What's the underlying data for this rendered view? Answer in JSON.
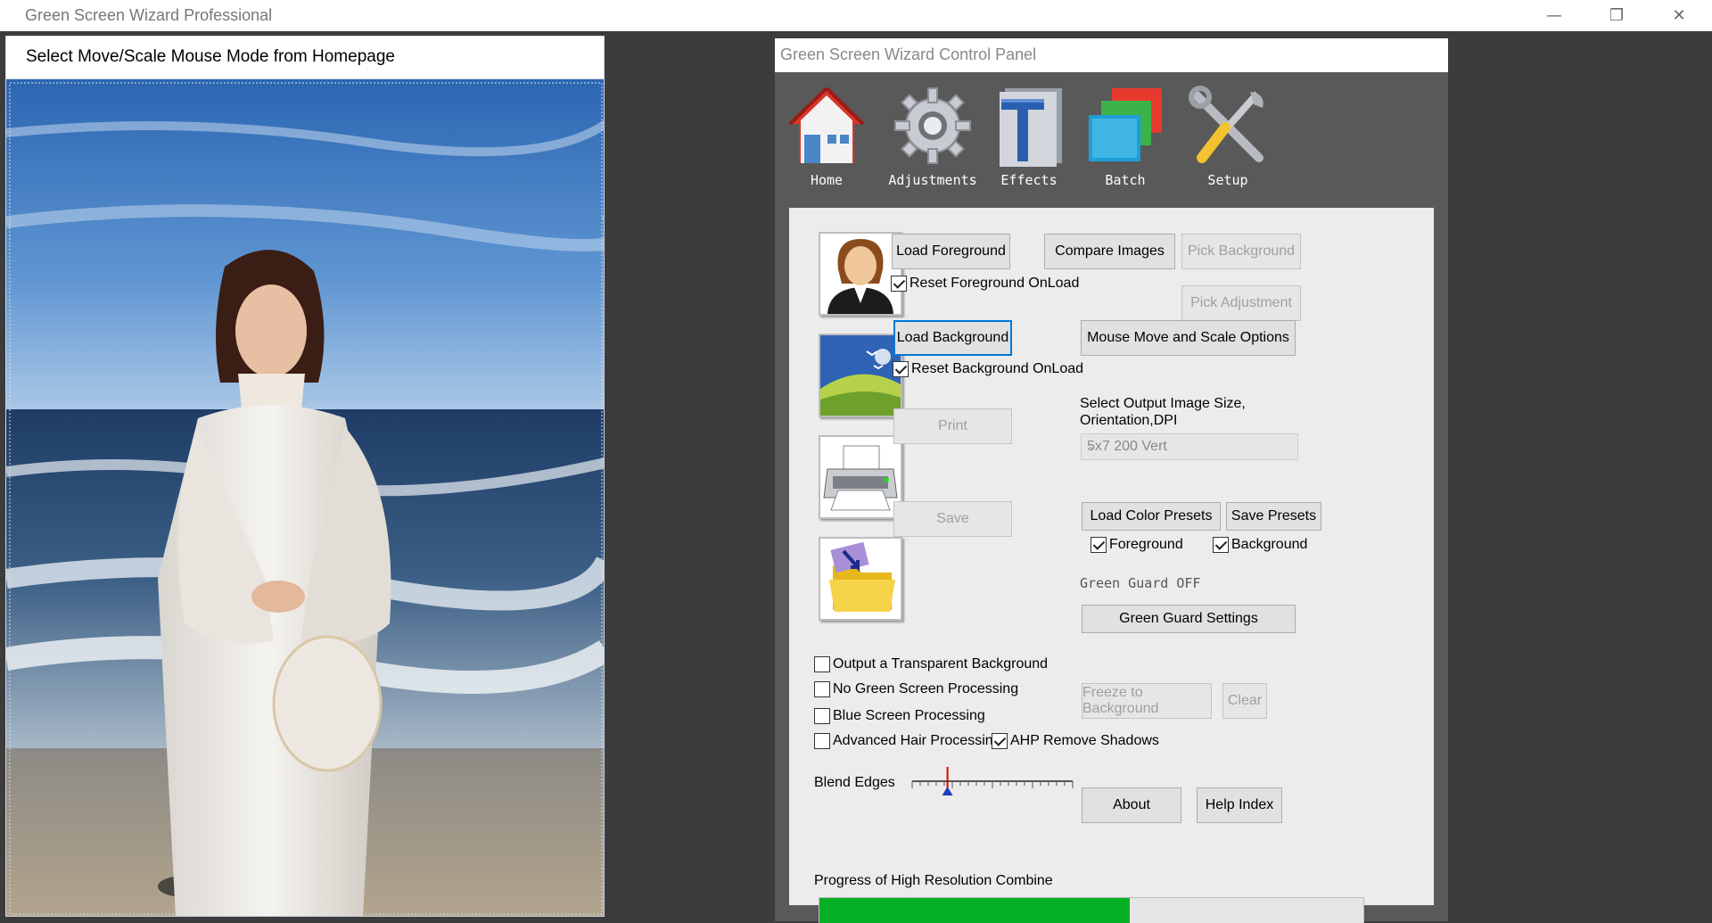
{
  "window": {
    "title": "Green Screen Wizard Professional",
    "minimize_glyph": "—",
    "maximize_glyph": "❐",
    "close_glyph": "✕"
  },
  "preview": {
    "header": "Select Move/Scale Mouse Mode from Homepage"
  },
  "control_panel": {
    "title": "Green Screen Wizard Control Panel",
    "toolbar": [
      {
        "label": "Home",
        "icon": "home-icon"
      },
      {
        "label": "Adjustments",
        "icon": "gear-icon"
      },
      {
        "label": "Effects",
        "icon": "effects-icon"
      },
      {
        "label": "Batch",
        "icon": "batch-icon"
      },
      {
        "label": "Setup",
        "icon": "tools-icon"
      }
    ],
    "buttons": {
      "load_foreground": "Load Foreground",
      "compare_images": "Compare Images",
      "pick_background": "Pick Background",
      "pick_adjustment": "Pick Adjustment",
      "load_background": "Load Background",
      "mouse_move_scale": "Mouse Move and Scale Options",
      "print": "Print",
      "save": "Save",
      "load_color_presets": "Load Color Presets",
      "save_presets": "Save Presets",
      "green_guard_settings": "Green Guard Settings",
      "freeze_to_background": "Freeze to Background",
      "clear": "Clear",
      "about": "About",
      "help_index": "Help Index"
    },
    "checkboxes": {
      "reset_foreground": {
        "label": "Reset Foreground OnLoad",
        "checked": true
      },
      "reset_background": {
        "label": "Reset Background OnLoad",
        "checked": true
      },
      "preset_foreground": {
        "label": "Foreground",
        "checked": true
      },
      "preset_background": {
        "label": "Background",
        "checked": true
      },
      "transparent_bg": {
        "label": "Output a Transparent Background",
        "checked": false
      },
      "no_green_screen": {
        "label": "No Green Screen Processing",
        "checked": false
      },
      "blue_screen": {
        "label": "Blue Screen Processing",
        "checked": false
      },
      "advanced_hair": {
        "label": "Advanced Hair Processing",
        "checked": false
      },
      "ahp_remove_shadows": {
        "label": "AHP Remove Shadows",
        "checked": true
      }
    },
    "output_size_label_line1": "Select Output Image Size,",
    "output_size_label_line2": "Orientation,DPI",
    "output_size_value": "5x7 200 Vert",
    "green_guard_status": "Green Guard OFF",
    "blend_edges_label": "Blend Edges",
    "blend_edges_value": 0.22,
    "progress_label": "Progress of High Resolution Combine",
    "progress_value": 0.57,
    "colors": {
      "progress_fill": "#06b025",
      "focus_border": "#0078d7",
      "panel_bg": "#595959"
    }
  }
}
